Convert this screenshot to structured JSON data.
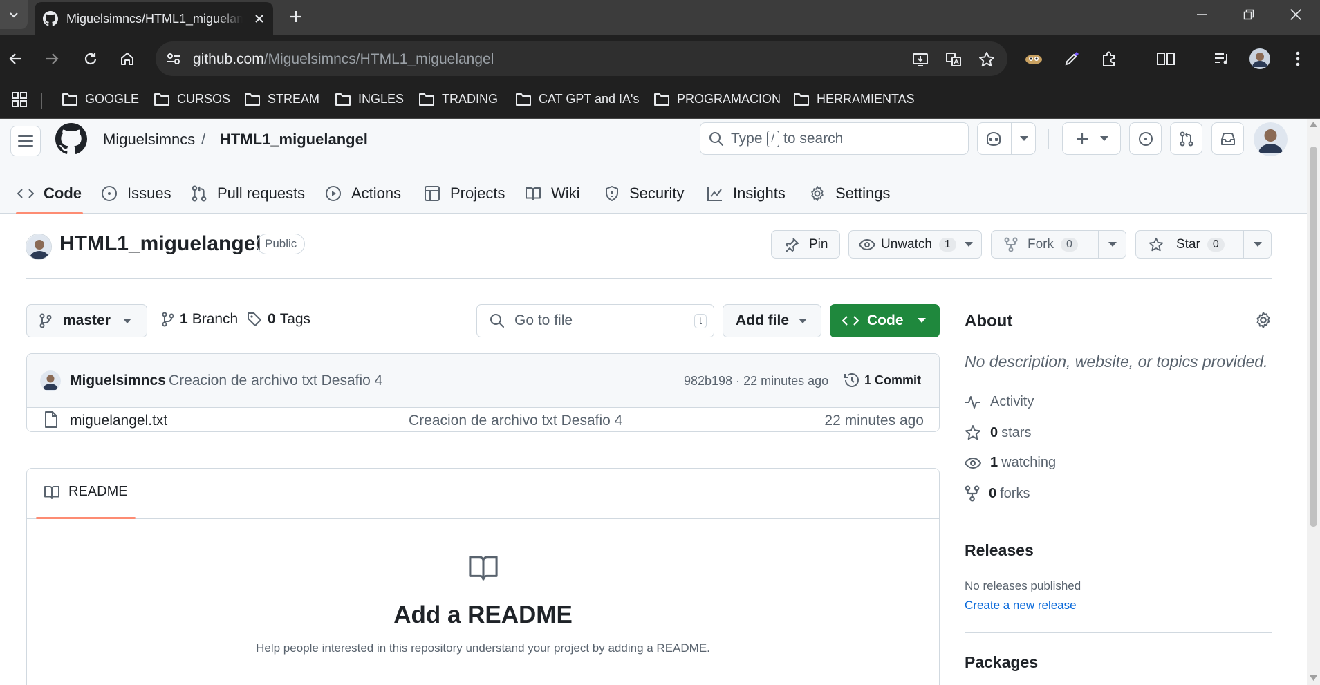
{
  "browser": {
    "tab_title": "Miguelsimncs/HTML1_miguelangel",
    "url_host": "github.com",
    "url_path": "/Miguelsimncs/HTML1_miguelangel",
    "bookmarks": [
      "GOOGLE",
      "CURSOS",
      "STREAM",
      "INGLES",
      "TRADING",
      "CAT GPT and IA's",
      "PROGRAMACION",
      "HERRAMIENTAS"
    ]
  },
  "header": {
    "owner": "Miguelsimncs",
    "separator": "/",
    "repo": "HTML1_miguelangel",
    "search_before": "Type",
    "search_key": "/",
    "search_after": "to search"
  },
  "repo_nav": [
    "Code",
    "Issues",
    "Pull requests",
    "Actions",
    "Projects",
    "Wiki",
    "Security",
    "Insights",
    "Settings"
  ],
  "repo": {
    "name": "HTML1_miguelangel",
    "visibility": "Public",
    "pin_label": "Pin",
    "unwatch_label": "Unwatch",
    "watch_count": "1",
    "fork_label": "Fork",
    "fork_count": "0",
    "star_label": "Star",
    "star_count": "0"
  },
  "branchbar": {
    "branch": "master",
    "branch_count": "1",
    "branch_label": "Branch",
    "tag_count": "0",
    "tag_label": "Tags",
    "goto_placeholder": "Go to file",
    "goto_key": "t",
    "add_file": "Add file",
    "code": "Code"
  },
  "latest_commit": {
    "author": "Miguelsimncs",
    "message": "Creacion de archivo txt Desafio 4",
    "meta": "982b198 · 22 minutes ago",
    "count_label": "1 Commit"
  },
  "files": [
    {
      "name": "miguelangel.txt",
      "commit": "Creacion de archivo txt Desafio 4",
      "time": "22 minutes ago"
    }
  ],
  "readme": {
    "tab": "README",
    "title": "Add a README",
    "subtitle": "Help people interested in this repository understand your project by adding a README."
  },
  "about": {
    "title": "About",
    "description": "No description, website, or topics provided.",
    "activity": "Activity",
    "stars_count": "0",
    "stars_label": "stars",
    "watching_count": "1",
    "watching_label": "watching",
    "forks_count": "0",
    "forks_label": "forks",
    "releases_title": "Releases",
    "releases_none": "No releases published",
    "releases_link": "Create a new release",
    "packages_title": "Packages"
  },
  "colors": {
    "accent_orange": "#fd8c73",
    "code_green": "#1f883d",
    "link_blue": "#0969da"
  }
}
